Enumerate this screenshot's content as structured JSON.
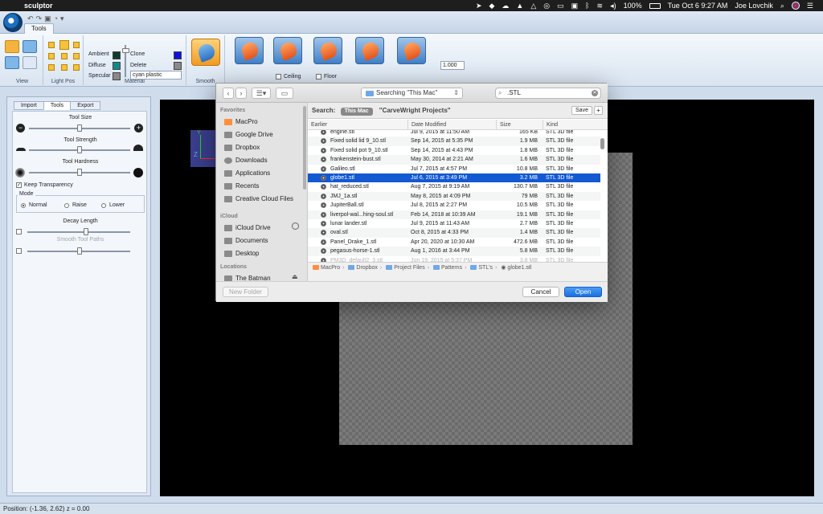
{
  "menubar": {
    "app_name": "sculptor",
    "battery": "100%",
    "datetime": "Tue Oct 6  9:27 AM",
    "user": "Joe Lovchik"
  },
  "ribbon": {
    "tab": "Tools",
    "groups": {
      "view": "View",
      "light_pos": "Light Pos",
      "material": "Material",
      "smooth": "Smooth"
    },
    "material": {
      "ambient": "Ambient",
      "diffuse": "Diffuse",
      "specular": "Specular",
      "clone": "Clone",
      "delete": "Delete",
      "selected": "cyan plastic",
      "ambient_color": "#0d3b2e",
      "diffuse_color": "#0d8a8a",
      "specular_color": "#8a8a8a",
      "clone_color": "#1010e0",
      "delete_color": "#8a8a8a"
    },
    "ceiling": "Ceiling",
    "floor": "Floor",
    "spinner_value": "1.000"
  },
  "left_panel": {
    "tabs": [
      "Import",
      "Tools",
      "Export"
    ],
    "active_tab": "Tools",
    "tool_size": "Tool Size",
    "tool_strength": "Tool Strength",
    "tool_hardness": "Tool Hardness",
    "keep_transparency": "Keep Transparency",
    "mode_label": "Mode",
    "modes": [
      "Normal",
      "Raise",
      "Lower"
    ],
    "decay_length": "Decay Length",
    "smooth_tool_paths": "Smooth Tool Paths"
  },
  "status": {
    "position": "Position: (-1.36, 2.62) z = 0.00"
  },
  "dialog": {
    "location": "Searching \"This Mac\"",
    "search": ".STL",
    "sidebar": {
      "favorites_head": "Favorites",
      "favorites": [
        "MacPro",
        "Google Drive",
        "Dropbox",
        "Downloads",
        "Applications",
        "Recents",
        "Creative Cloud Files"
      ],
      "icloud_head": "iCloud",
      "icloud": [
        "iCloud Drive",
        "Documents",
        "Desktop"
      ],
      "locations_head": "Locations",
      "locations": [
        "The Batman"
      ]
    },
    "scope": {
      "label": "Search:",
      "this_mac": "This Mac",
      "project": "\"CarveWright Projects\"",
      "save": "Save",
      "add": "+"
    },
    "columns": [
      "Earlier",
      "Date Modified",
      "Size",
      "Kind"
    ],
    "files": [
      {
        "name": "engine.stl",
        "date": "Jul 9, 2015 at 11:50 AM",
        "size": "165 KB",
        "kind": "STL 3D file"
      },
      {
        "name": "Fixed solid lid 9_10.stl",
        "date": "Sep 14, 2015 at 5:35 PM",
        "size": "1.9 MB",
        "kind": "STL 3D file"
      },
      {
        "name": "Fixed solid pot 9_10.stl",
        "date": "Sep 14, 2015 at 4:43 PM",
        "size": "1.8 MB",
        "kind": "STL 3D file"
      },
      {
        "name": "frankenstein-bust.stl",
        "date": "May 30, 2014 at 2:21 AM",
        "size": "1.6 MB",
        "kind": "STL 3D file"
      },
      {
        "name": "Galileo.stl",
        "date": "Jul 7, 2015 at 4:57 PM",
        "size": "10.8 MB",
        "kind": "STL 3D file"
      },
      {
        "name": "globe1.stl",
        "date": "Jul 6, 2015 at 3:49 PM",
        "size": "3.2 MB",
        "kind": "STL 3D file"
      },
      {
        "name": "hat_reduced.stl",
        "date": "Aug 7, 2015 at 9:19 AM",
        "size": "130.7 MB",
        "kind": "STL 3D file"
      },
      {
        "name": "JMJ_1a.stl",
        "date": "May 8, 2015 at 4:09 PM",
        "size": "79 MB",
        "kind": "STL 3D file"
      },
      {
        "name": "JupiterBall.stl",
        "date": "Jul 8, 2015 at 2:27 PM",
        "size": "10.5 MB",
        "kind": "STL 3D file"
      },
      {
        "name": "liverpol-wal...hing-soul.stl",
        "date": "Feb 14, 2018 at 10:39 AM",
        "size": "19.1 MB",
        "kind": "STL 3D file"
      },
      {
        "name": "lunar lander.stl",
        "date": "Jul 9, 2015 at 11:43 AM",
        "size": "2.7 MB",
        "kind": "STL 3D file"
      },
      {
        "name": "oval.stl",
        "date": "Oct 8, 2015 at 4:33 PM",
        "size": "1.4 MB",
        "kind": "STL 3D file"
      },
      {
        "name": "Panel_Drake_1.stl",
        "date": "Apr 20, 2020 at 10:30 AM",
        "size": "472.6 MB",
        "kind": "STL 3D file"
      },
      {
        "name": "pegasus-horse-1.stl",
        "date": "Aug 1, 2016 at 3:44 PM",
        "size": "5.8 MB",
        "kind": "STL 3D file"
      },
      {
        "name": "PM3D_default2_3.stl",
        "date": "Jun 19, 2015 at 5:37 PM",
        "size": "3.8 MB",
        "kind": "STL 3D file"
      }
    ],
    "selected_index": 5,
    "path": [
      "MacPro",
      "Dropbox",
      "Project Files",
      "Patterns",
      "STL's",
      "globe1.stl"
    ],
    "new_folder": "New Folder",
    "cancel": "Cancel",
    "open": "Open"
  }
}
